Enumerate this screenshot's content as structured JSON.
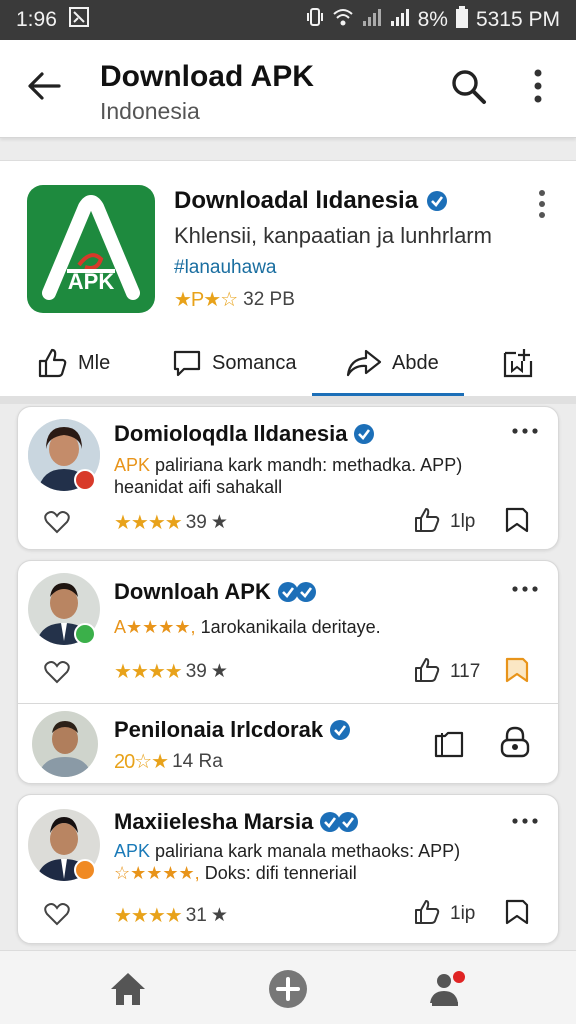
{
  "status": {
    "time": "1:96",
    "battery": "8%",
    "clock": "5315 PM"
  },
  "appbar": {
    "title": "Download APK",
    "subtitle": "Indonesia"
  },
  "app": {
    "name": "Downloadal lıdanesia",
    "description": "Khlensii, kanpaatian ja lunhrlarm",
    "tag": "#lanauhawa",
    "stars": "★P★☆",
    "size": "32 PB",
    "icon_text": "APK",
    "brand_color": "#1e8a3e"
  },
  "tabs": [
    {
      "label": "Mle",
      "icon": "thumb-up-icon"
    },
    {
      "label": "Somanca",
      "icon": "comment-icon"
    },
    {
      "label": "Abde",
      "icon": "share-icon"
    },
    {
      "label": "",
      "icon": "bookmark-add-icon"
    }
  ],
  "cards": [
    {
      "name": "Domioloqdla lldanesia",
      "line1_prefix": "APK",
      "line1": " paliriana kark mandh: methadka. APP)",
      "line2": "heanidat aifi sahakall",
      "stars": "★★★★",
      "rating": "39",
      "count": "1lp"
    },
    {
      "name": "Downloah APK",
      "line1_prefix": "A★★★★,",
      "line1": " 1arokanikaila deritaye.",
      "stars": "★★★★",
      "rating": "39",
      "count": "117"
    },
    {
      "name": "Penilonaia lrlcdorak",
      "rating_prefix": "20☆★",
      "rating": "14 Ra"
    },
    {
      "name": "Maxiielesha Marsia",
      "line1_prefix": "APK",
      "line1": " paliriana kark manala methaoks: APP)",
      "line2_prefix": "☆★★★★,",
      "line2": " Doks: difi tenneriail",
      "stars": "★★★★",
      "rating": "31",
      "count": "1ip"
    }
  ],
  "colors": {
    "accent": "#1c6fb8",
    "star": "#e8a21a",
    "verified": "#1c6fb8"
  }
}
